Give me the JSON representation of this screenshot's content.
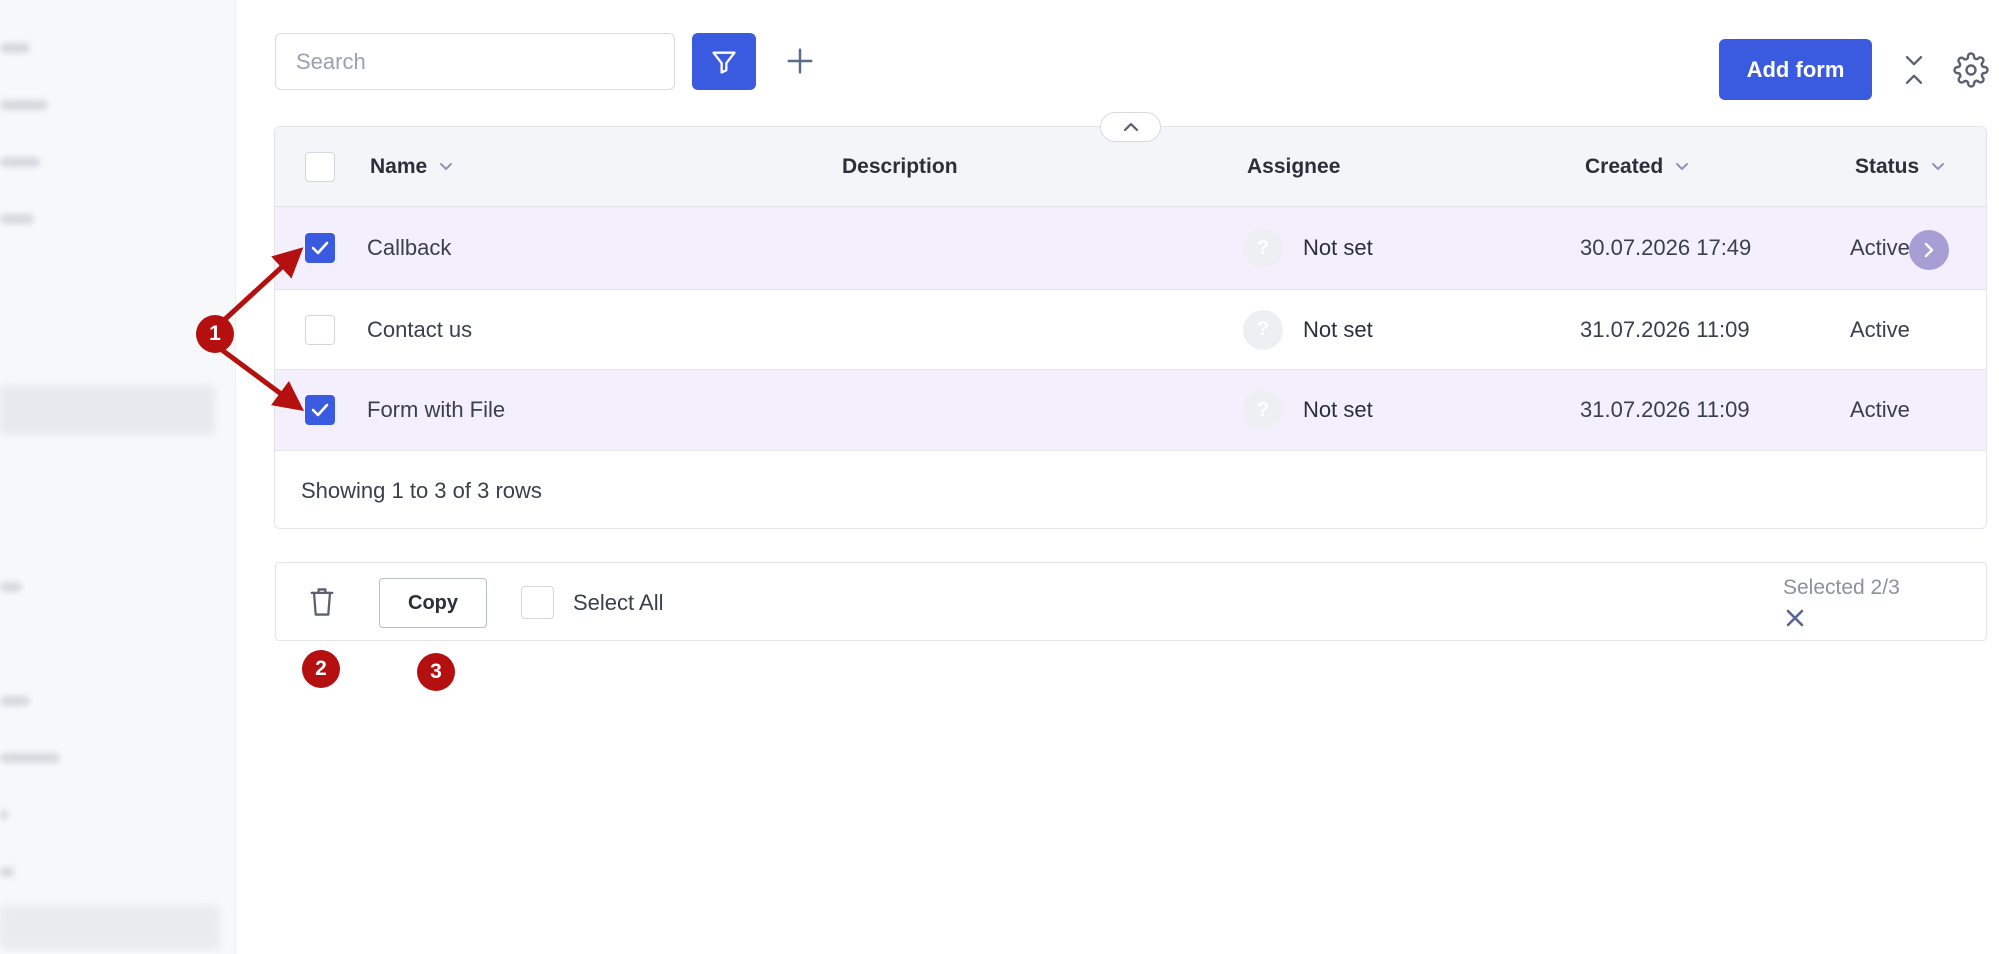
{
  "toolbar": {
    "search_placeholder": "Search",
    "filter_icon": "filter-icon",
    "add_icon": "plus-icon",
    "add_form_label": "Add form",
    "collapse_icon": "collapse-icon",
    "settings_icon": "gear-icon"
  },
  "table": {
    "columns": {
      "name": "Name",
      "description": "Description",
      "assignee": "Assignee",
      "created": "Created",
      "status": "Status"
    },
    "rows": [
      {
        "name": "Callback",
        "description": "",
        "assignee": "Not set",
        "created": "30.07.2026 17:49",
        "status": "Active",
        "selected": true
      },
      {
        "name": "Contact us",
        "description": "",
        "assignee": "Not set",
        "created": "31.07.2026 11:09",
        "status": "Active",
        "selected": false
      },
      {
        "name": "Form with File",
        "description": "",
        "assignee": "Not set",
        "created": "31.07.2026 11:09",
        "status": "Active",
        "selected": true
      }
    ],
    "avatar_placeholder": "?",
    "footer": "Showing 1 to 3 of 3 rows"
  },
  "bulk_actions": {
    "delete_icon": "trash-icon",
    "copy_label": "Copy",
    "select_all_label": "Select All",
    "selected_count": "Selected 2/3",
    "clear_icon": "close-icon"
  },
  "annotations": {
    "marker_1": "1",
    "marker_2": "2",
    "marker_3": "3"
  },
  "colors": {
    "accent": "#3a5be0",
    "selected_row": "#f3effc",
    "marker": "#b3100f"
  }
}
